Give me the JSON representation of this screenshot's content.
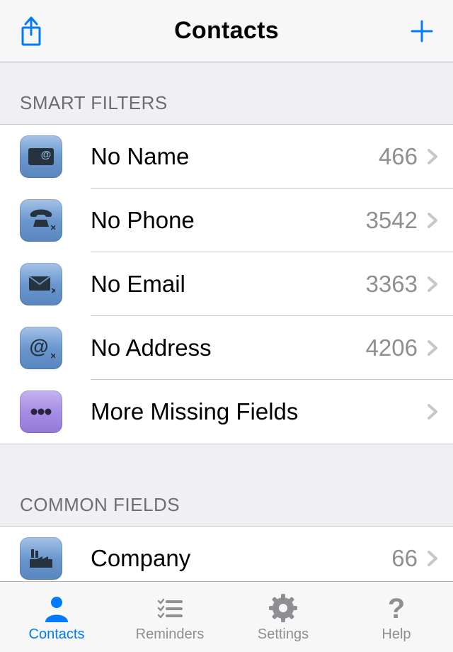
{
  "header": {
    "title": "Contacts"
  },
  "sections": {
    "smart_filters": {
      "header": "SMART FILTERS",
      "items": [
        {
          "icon": "card-at-icon",
          "icon_tint": "blue",
          "label": "No Name",
          "count": "466"
        },
        {
          "icon": "phone-x-icon",
          "icon_tint": "blue",
          "label": "No Phone",
          "count": "3542"
        },
        {
          "icon": "mail-x-icon",
          "icon_tint": "blue",
          "label": "No Email",
          "count": "3363"
        },
        {
          "icon": "at-x-icon",
          "icon_tint": "blue",
          "label": "No Address",
          "count": "4206"
        },
        {
          "icon": "ellipsis-icon",
          "icon_tint": "purple",
          "label": "More Missing Fields",
          "count": ""
        }
      ]
    },
    "common_fields": {
      "header": "COMMON FIELDS",
      "items": [
        {
          "icon": "factory-icon",
          "icon_tint": "blue",
          "label": "Company",
          "count": "66"
        }
      ]
    }
  },
  "tabs": [
    {
      "icon": "person-icon",
      "label": "Contacts",
      "active": true
    },
    {
      "icon": "checklist-icon",
      "label": "Reminders",
      "active": false
    },
    {
      "icon": "gear-icon",
      "label": "Settings",
      "active": false
    },
    {
      "icon": "question-icon",
      "label": "Help",
      "active": false
    }
  ]
}
